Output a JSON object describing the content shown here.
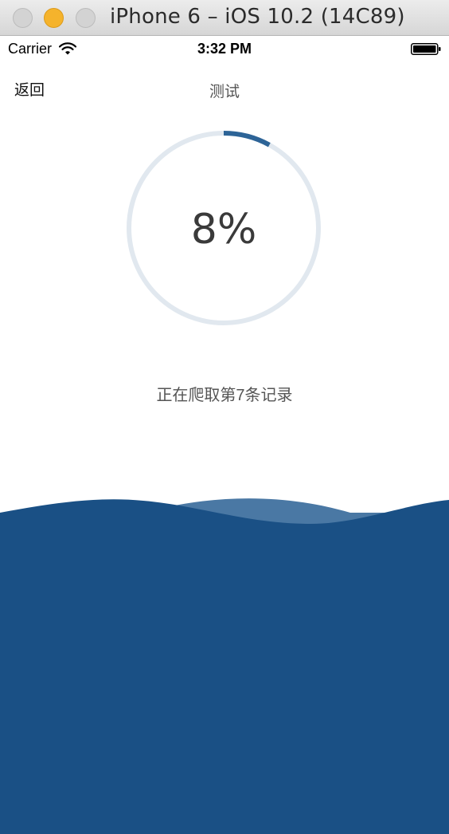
{
  "window": {
    "title": "iPhone 6 – iOS 10.2 (14C89)"
  },
  "status_bar": {
    "carrier": "Carrier",
    "time": "3:32 PM"
  },
  "nav": {
    "back_label": "返回",
    "title": "测试"
  },
  "progress": {
    "value": 0.08,
    "label": "8%",
    "message": "正在爬取第7条记录"
  },
  "colors": {
    "ring_track": "#e1e8ef",
    "ring_progress": "#2d6497",
    "wave_front": "#1a5085",
    "wave_back": "#4a78a4"
  },
  "icons": {
    "wifi": "wifi-icon",
    "battery": "battery-icon"
  }
}
